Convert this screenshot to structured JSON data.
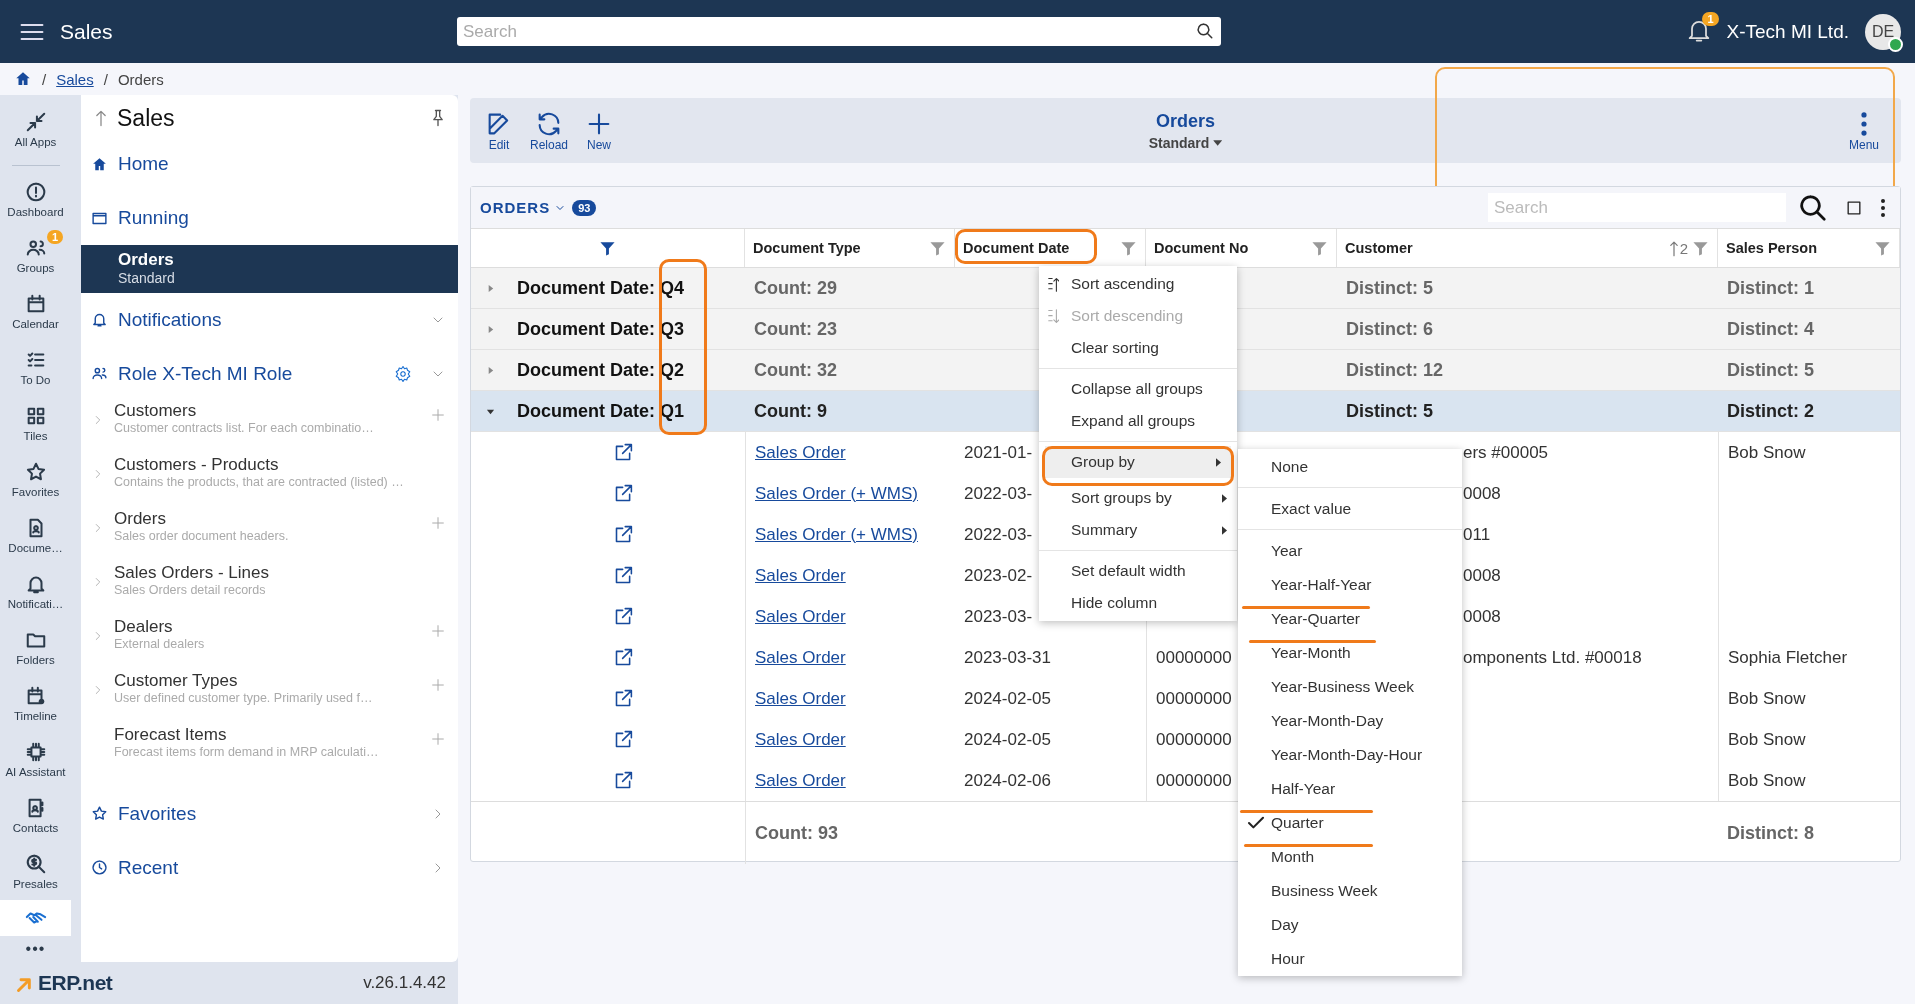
{
  "app_bar": {
    "title": "Sales",
    "search": {
      "placeholder": "Search"
    },
    "notifications": "1",
    "company": "X-Tech MI Ltd.",
    "avatar": "DE",
    "online": true
  },
  "breadcrumb": {
    "separator": "/",
    "items": [
      {
        "label": "Sales",
        "link": true
      },
      {
        "label": "Orders",
        "link": false
      }
    ]
  },
  "rail": {
    "items": [
      {
        "label": "All Apps",
        "selected": false
      },
      {
        "label": "Dashboard",
        "selected": false
      },
      {
        "label": "Groups",
        "selected": false,
        "badge": "1"
      },
      {
        "label": "Calendar",
        "selected": false
      },
      {
        "label": "To Do",
        "selected": false
      },
      {
        "label": "Tiles",
        "selected": false
      },
      {
        "label": "Favorites",
        "selected": false
      },
      {
        "label": "Docume…",
        "selected": false
      },
      {
        "label": "Notificati…",
        "selected": false
      },
      {
        "label": "Folders",
        "selected": false
      },
      {
        "label": "Timeline",
        "selected": false
      },
      {
        "label": "AI Assistant",
        "selected": false
      },
      {
        "label": "Contacts",
        "selected": false
      },
      {
        "label": "Presales",
        "selected": false
      },
      {
        "selected": true
      }
    ],
    "more": "•••"
  },
  "sidebar": {
    "title": "Sales",
    "home": "Home",
    "running": {
      "label": "Running",
      "items": [
        {
          "title": "Orders",
          "subtitle": "Standard",
          "selected": true
        }
      ]
    },
    "notifications": "Notifications",
    "role": {
      "label": "Role X-Tech MI Role",
      "items": [
        {
          "name": "Customers",
          "description": "Customer contracts list. For each combinatio…",
          "expandable": true,
          "addable": true
        },
        {
          "name": "Customers - Products",
          "description": "Contains the products, that are contracted (listed) …",
          "expandable": true,
          "addable": false
        },
        {
          "name": "Orders",
          "description": "Sales order document headers.",
          "expandable": true,
          "addable": true
        },
        {
          "name": "Sales Orders - Lines",
          "description": "Sales Orders detail records",
          "expandable": true,
          "addable": false
        },
        {
          "name": "Dealers",
          "description": "External dealers",
          "expandable": true,
          "addable": true
        },
        {
          "name": "Customer Types",
          "description": "User defined customer type. Primarily used f…",
          "expandable": true,
          "addable": true
        },
        {
          "name": "Forecast Items",
          "description": "Forecast items form demand in MRP calculati…",
          "expandable": false,
          "addable": true
        }
      ]
    },
    "favorites": "Favorites",
    "recent": "Recent"
  },
  "footer": {
    "logo": "ERP.net",
    "version": "v.26.1.4.42"
  },
  "toolbar": {
    "buttons": [
      {
        "label": "Edit"
      },
      {
        "label": "Reload"
      },
      {
        "label": "New"
      }
    ],
    "title": "Orders",
    "view": "Standard",
    "menu": "Menu"
  },
  "table": {
    "title": "ORDERS",
    "count": "93",
    "search": {
      "placeholder": "Search"
    },
    "columns": [
      {
        "filter_active": true
      },
      {
        "label": "Document Type",
        "filter_active": false
      },
      {
        "label": "Document Date",
        "filter_active": false
      },
      {
        "label": "Document No",
        "filter_active": false
      },
      {
        "label": "Customer",
        "sort_order": "2",
        "filter_active": false
      },
      {
        "label": "Sales Person",
        "filter_active": false
      }
    ],
    "groups": [
      {
        "label": "Document Date: Q4",
        "count": "Count: 29",
        "customer": "Distinct: 5",
        "sales_person": "Distinct: 1",
        "expanded": false,
        "selected": false
      },
      {
        "label": "Document Date: Q3",
        "count": "Count: 23",
        "customer": "Distinct: 6",
        "sales_person": "Distinct: 4",
        "expanded": false,
        "selected": false
      },
      {
        "label": "Document Date: Q2",
        "count": "Count: 32",
        "customer": "Distinct: 12",
        "sales_person": "Distinct: 5",
        "expanded": false,
        "selected": false
      },
      {
        "label": "Document Date: Q1",
        "count": "Count: 9",
        "customer": "Distinct: 5",
        "sales_person": "Distinct: 2",
        "expanded": true,
        "selected": true,
        "rows": [
          {
            "type": "Sales Order",
            "date": "2021-01-",
            "customer": "ers #00005",
            "sales_person": "Bob Snow"
          },
          {
            "type": "Sales Order (+ WMS)",
            "date": "2022-03-",
            "customer": "0008"
          },
          {
            "type": "Sales Order (+ WMS)",
            "date": "2022-03-",
            "customer": "011"
          },
          {
            "type": "Sales Order",
            "date": "2023-02-",
            "customer": "0008"
          },
          {
            "type": "Sales Order",
            "date": "2023-03-",
            "customer": "0008"
          },
          {
            "type": "Sales Order",
            "date": "2023-03-31",
            "doc_no": "00000000",
            "customer": "omponents Ltd. #00018",
            "sales_person": "Sophia Fletcher"
          },
          {
            "type": "Sales Order",
            "date": "2024-02-05",
            "doc_no": "00000000",
            "sales_person": "Bob Snow"
          },
          {
            "type": "Sales Order",
            "date": "2024-02-05",
            "doc_no": "00000000",
            "sales_person": "Bob Snow"
          },
          {
            "type": "Sales Order",
            "date": "2024-02-06",
            "doc_no": "00000000",
            "sales_person": "Bob Snow"
          }
        ]
      }
    ],
    "totals": {
      "count": "Count: 93",
      "sales_person": "Distinct: 8"
    }
  },
  "column_menu": {
    "items": [
      {
        "kind": "sort",
        "label": "Sort ascending",
        "disabled": false,
        "selected": false
      },
      {
        "kind": "sort",
        "label": "Sort descending",
        "disabled": true,
        "selected": false
      },
      {
        "kind": "item",
        "label": "Clear sorting",
        "disabled": false,
        "selected": false
      },
      {
        "kind": "separator"
      },
      {
        "kind": "item",
        "label": "Collapse all groups",
        "disabled": false,
        "selected": false
      },
      {
        "kind": "item",
        "label": "Expand all groups",
        "disabled": false,
        "selected": false
      },
      {
        "kind": "separator"
      },
      {
        "kind": "submenu",
        "label": "Group by",
        "disabled": false,
        "selected": true
      },
      {
        "kind": "submenu",
        "label": "Sort groups by",
        "disabled": false,
        "selected": false
      },
      {
        "kind": "submenu",
        "label": "Summary",
        "disabled": false,
        "selected": false
      },
      {
        "kind": "separator"
      },
      {
        "kind": "item",
        "label": "Set default width",
        "disabled": false,
        "selected": false
      },
      {
        "kind": "item",
        "label": "Hide column",
        "disabled": false,
        "selected": false
      }
    ]
  },
  "group_by_menu": {
    "items": [
      {
        "kind": "item",
        "label": "None",
        "checked": false
      },
      {
        "kind": "separator"
      },
      {
        "kind": "item",
        "label": "Exact value",
        "checked": false
      },
      {
        "kind": "separator"
      },
      {
        "kind": "item",
        "label": "Year",
        "checked": false
      },
      {
        "kind": "item",
        "label": "Year-Half-Year",
        "checked": false
      },
      {
        "kind": "item",
        "label": "Year-Quarter",
        "checked": false
      },
      {
        "kind": "item",
        "label": "Year-Month",
        "checked": false
      },
      {
        "kind": "item",
        "label": "Year-Business Week",
        "checked": false
      },
      {
        "kind": "item",
        "label": "Year-Month-Day",
        "checked": false
      },
      {
        "kind": "item",
        "label": "Year-Month-Day-Hour",
        "checked": false
      },
      {
        "kind": "item",
        "label": "Half-Year",
        "checked": false
      },
      {
        "kind": "item",
        "label": "Quarter",
        "checked": true
      },
      {
        "kind": "item",
        "label": "Month",
        "checked": false
      },
      {
        "kind": "item",
        "label": "Business Week",
        "checked": false
      },
      {
        "kind": "item",
        "label": "Day",
        "checked": false
      },
      {
        "kind": "item",
        "label": "Hour",
        "checked": false
      }
    ]
  }
}
